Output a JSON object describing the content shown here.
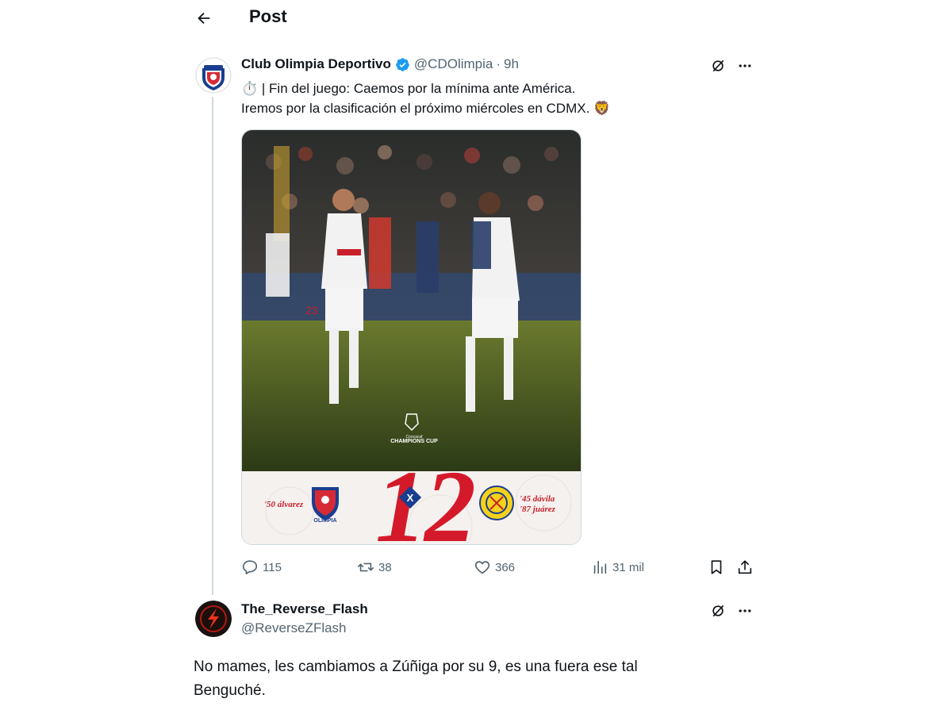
{
  "header": {
    "title": "Post",
    "back_icon": "arrow-left-icon"
  },
  "post": {
    "author_name": "Club Olimpia Deportivo",
    "verified": true,
    "handle": "@CDOlimpia",
    "separator": "·",
    "time": "9h",
    "text_line1": "⏱️ | Fin del juego: Caemos por la mínima ante América.",
    "text_line2": "Iremos por la clasificación el próximo miércoles en CDMX. 🦁",
    "media": {
      "tournament": "CHAMPIONS CUP",
      "tournament_sub": "Concacaf",
      "score_home": "1",
      "score_away": "2",
      "separator": "X",
      "scorers_home": "'50 álvarez",
      "scorers_away_1": "'45 dávila",
      "scorers_away_2": "'87 juárez",
      "home_badge_text": "OLIMPIA",
      "player_number": "23"
    },
    "stats": {
      "replies": "115",
      "reposts": "38",
      "likes": "366",
      "views": "31 mil"
    }
  },
  "reply": {
    "author_name": "The_Reverse_Flash",
    "handle": "@ReverseZFlash",
    "text_line1": "No mames, les cambiamos a Zúñiga por su 9, es una fuera ese tal",
    "text_line2": "Benguché."
  },
  "colors": {
    "text_primary": "#0f1419",
    "text_secondary": "#536471",
    "verified_blue": "#1d9bf0",
    "border": "#cfd9de",
    "score_red": "#d41a2a"
  }
}
